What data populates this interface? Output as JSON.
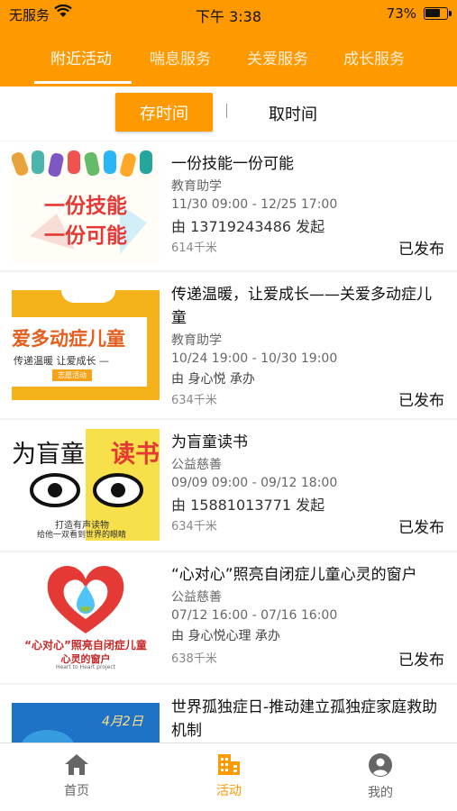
{
  "status_bar": {
    "carrier": "无服务",
    "time": "下午 3:38",
    "battery": "73%"
  },
  "top_tabs": [
    "附近活动",
    "喘息服务",
    "关爱服务",
    "成长服务"
  ],
  "sub_tabs": {
    "active": "存时间",
    "other": "取时间"
  },
  "activities": [
    {
      "title": "一份技能一份可能",
      "category": "教育助学",
      "time": "11/30 09:00 - 12/25 17:00",
      "organizer": "由 13719243486 发起",
      "distance": "614千米",
      "status": "已发布",
      "thumb_text": [
        "一份技能",
        "一份可能"
      ]
    },
    {
      "title": "传递温暖，让爱成长——关爱多动症儿童",
      "category": "教育助学",
      "time": "10/24 19:00 - 10/30 19:00",
      "organizer": "由 身心悦 承办",
      "distance": "634千米",
      "status": "已发布",
      "thumb_text": [
        "爱多动症儿童",
        "传递温暖 让爱成长 —",
        "志愿活动"
      ]
    },
    {
      "title": "为盲童读书",
      "category": "公益慈善",
      "time": "09/09 09:00 - 09/12 18:00",
      "organizer": "由 15881013771 发起",
      "distance": "634千米",
      "status": "已发布",
      "thumb_text": [
        "为盲童",
        "读书",
        "打造有声读物",
        "给他一双看到世界的眼睛"
      ]
    },
    {
      "title": "“心对心”照亮自闭症儿童心灵的窗户",
      "category": "公益慈善",
      "time": "07/12 16:00 - 07/16 16:00",
      "organizer": "由 身心悦心理 承办",
      "distance": "638千米",
      "status": "已发布",
      "thumb_text": [
        "“心对心”照亮自闭症儿童",
        "心灵的窗户",
        "Heart to Heart project"
      ]
    },
    {
      "title": "世界孤独症日-推动建立孤独症家庭救助机制",
      "thumb_text": [
        "4月2日"
      ]
    }
  ],
  "bottom_tabs": {
    "home": "首页",
    "activity": "活动",
    "mine": "我的"
  },
  "colors": {
    "accent": "#ff9900"
  }
}
